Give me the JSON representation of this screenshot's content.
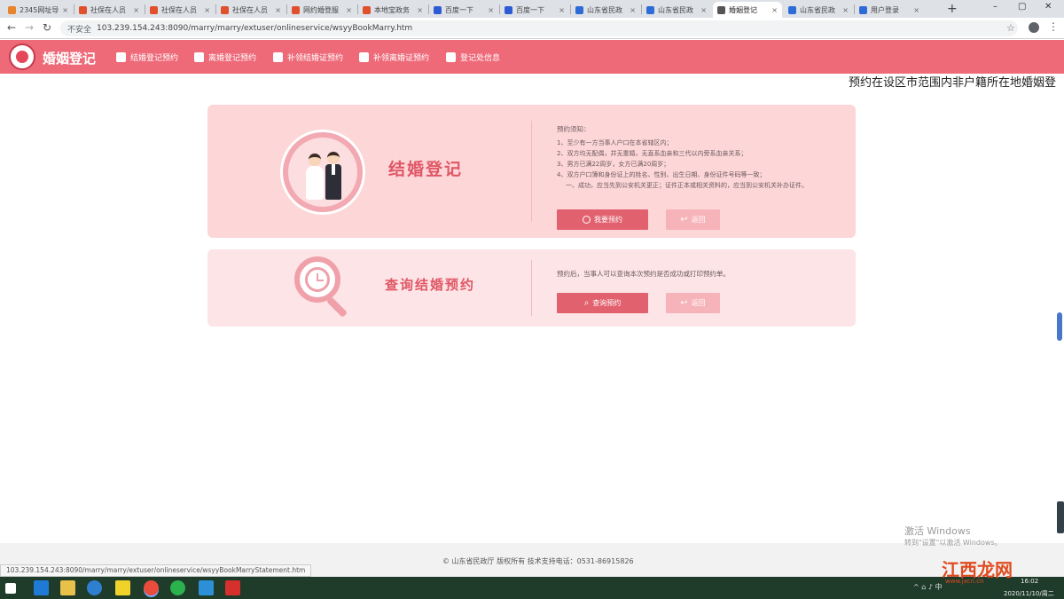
{
  "browser": {
    "tabs": [
      {
        "label": "2345网址导",
        "fav": "#e8842b"
      },
      {
        "label": "社保在人员",
        "fav": "#e0502c"
      },
      {
        "label": "社保在人员",
        "fav": "#e0502c"
      },
      {
        "label": "社保在人员",
        "fav": "#e0502c"
      },
      {
        "label": "网约婚登服",
        "fav": "#e0502c"
      },
      {
        "label": "本地宝政务",
        "fav": "#e0502c"
      },
      {
        "label": "百度一下",
        "fav": "#2d5bd6"
      },
      {
        "label": "百度一下",
        "fav": "#2d5bd6"
      },
      {
        "label": "山东省民政",
        "fav": "#2d6bd6"
      },
      {
        "label": "山东省民政",
        "fav": "#2d6bd6"
      },
      {
        "label": "婚姻登记",
        "fav": "#555555"
      },
      {
        "label": "山东省民政",
        "fav": "#2d6bd6"
      },
      {
        "label": "用户登录",
        "fav": "#2d6bd6"
      }
    ],
    "active_tab": 10,
    "security_label": "不安全",
    "url": "103.239.154.243:8090/marry/marry/extuser/onlineservice/wsyyBookMarry.htm",
    "new_tab_symbol": "+",
    "minimize_symbol": "–",
    "maximize_symbol": "▢",
    "close_symbol": "✕",
    "back_symbol": "←",
    "forward_symbol": "→",
    "reload_symbol": "↻",
    "star_symbol": "☆",
    "menu_symbol": "⋮"
  },
  "header": {
    "site_title": "婚姻登记",
    "nav": [
      {
        "label": "结婚登记预约",
        "icon": "person-icon"
      },
      {
        "label": "离婚登记预约",
        "icon": "person-icon"
      },
      {
        "label": "补领结婚证预约",
        "icon": "certificate-icon"
      },
      {
        "label": "补领离婚证预约",
        "icon": "certificate-icon"
      },
      {
        "label": "登记处信息",
        "icon": "home-icon"
      }
    ]
  },
  "marquee_text": "预约在设区市范围内非户籍所在地婚姻登",
  "card_marriage": {
    "title": "结婚登记",
    "notice_heading": "预约须知：",
    "notice_lines": [
      "1、至少有一方当事人户口在本省辖区内；",
      "2、双方均无配偶，并无重婚，无直系血亲和三代以内旁系血亲关系；",
      "3、男方已满22周岁，女方已满20周岁；",
      "4、双方户口簿和身份证上的姓名、性别、出生日期、身份证件号码等一致；",
      "一、成功，应当先到公安机关更正；证件正本或相关资料的，应当到公安机关补办证件。"
    ],
    "book_button": "我要预约",
    "back_button": "返回"
  },
  "card_query": {
    "title": "查询结婚预约",
    "notice": "预约后，当事人可以查询本次预约是否成功或打印预约单。",
    "query_button": "查询预约",
    "back_button": "返回"
  },
  "footer": {
    "copyright": "© 山东省民政厅 版权所有    技术支持电话：0531-86915826",
    "status_url": "103.239.154.243:8090/marry/marry/extuser/onlineservice/wsyyBookMarryStatement.htm"
  },
  "overlay": {
    "watermark_title": "激活 Windows",
    "watermark_sub": "转到\"设置\"以激活 Windows。",
    "site_logo": "江西龙网",
    "site_logo_url": "www.jxcn.cn"
  },
  "taskbar": {
    "time": "16:02",
    "date": "2020/11/10/周二",
    "tray_text": "^  ⌂  ♪  中"
  },
  "colors": {
    "brand": "#ee6a79",
    "card1_bg": "#fdd6d8",
    "card2_bg": "#fde4e6",
    "primary_button": "#e2616f",
    "back_button": "#f6b3b9"
  }
}
